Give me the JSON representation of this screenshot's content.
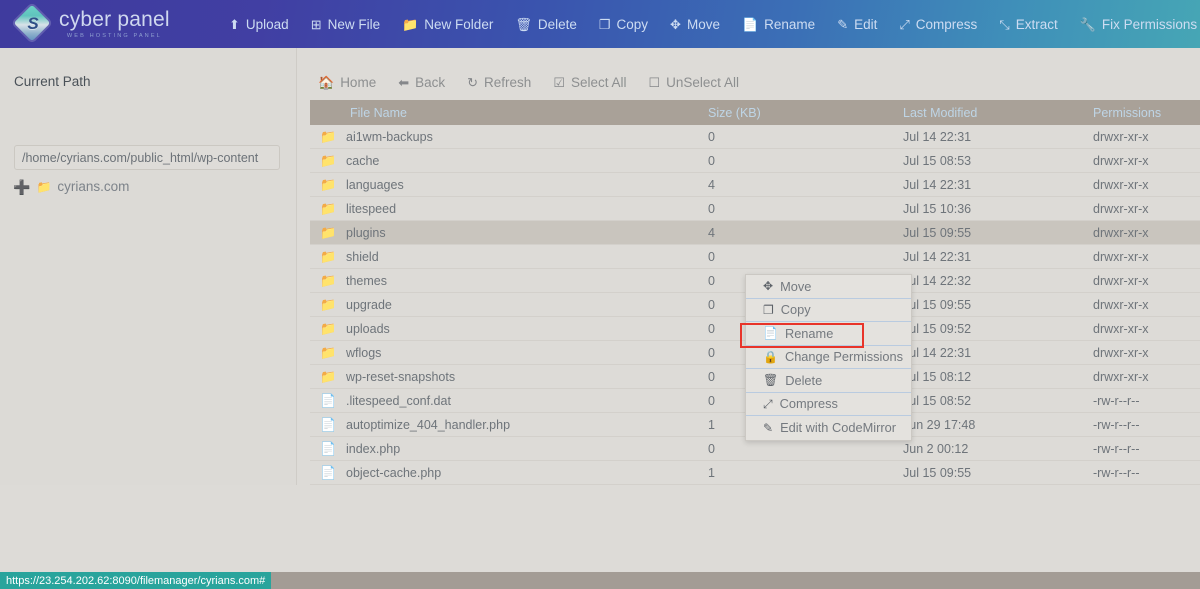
{
  "brand": {
    "name": "cyber panel",
    "tagline": "WEB HOSTING PANEL",
    "logo_icon": "diamond-logo-icon",
    "bolt_glyph": "S"
  },
  "topnav": {
    "items": [
      {
        "label": "Upload",
        "icon": "upload-icon",
        "glyph": "⬆"
      },
      {
        "label": "New File",
        "icon": "new-file-icon",
        "glyph": "⊞"
      },
      {
        "label": "New Folder",
        "icon": "new-folder-icon",
        "glyph": "📁"
      },
      {
        "label": "Delete",
        "icon": "trash-icon",
        "glyph": "🗑"
      },
      {
        "label": "Copy",
        "icon": "copy-icon",
        "glyph": "❐"
      },
      {
        "label": "Move",
        "icon": "move-icon",
        "glyph": "✥"
      },
      {
        "label": "Rename",
        "icon": "rename-document-icon",
        "glyph": "📄"
      },
      {
        "label": "Edit",
        "icon": "edit-pencil-icon",
        "glyph": "✎"
      },
      {
        "label": "Compress",
        "icon": "compress-icon",
        "glyph": "⤢"
      },
      {
        "label": "Extract",
        "icon": "extract-icon",
        "glyph": "⤡"
      },
      {
        "label": "Fix Permissions",
        "icon": "wrench-icon",
        "glyph": "🔧"
      }
    ]
  },
  "sidebar": {
    "title": "Current Path",
    "path_value": "/home/cyrians.com/public_html/wp-content",
    "path_placeholder": "/home/cyrians.com/public_html/wp-content",
    "tree": {
      "expand_glyph": "➕",
      "folder_icon": "folder-icon",
      "folder_glyph": "📁",
      "label": "cyrians.com"
    }
  },
  "actionbar": {
    "items": [
      {
        "label": "Home",
        "icon": "home-icon",
        "glyph": "🏠"
      },
      {
        "label": "Back",
        "icon": "arrow-left-icon",
        "glyph": "⬅"
      },
      {
        "label": "Refresh",
        "icon": "refresh-icon",
        "glyph": "↻"
      },
      {
        "label": "Select All",
        "icon": "checkbox-checked-icon",
        "glyph": "☑"
      },
      {
        "label": "UnSelect All",
        "icon": "checkbox-empty-icon",
        "glyph": "☐"
      }
    ]
  },
  "table": {
    "columns": [
      "File Name",
      "Size (KB)",
      "Last Modified",
      "Permissions"
    ],
    "rows": [
      {
        "name": "ai1wm-backups",
        "type": "folder",
        "size": "0",
        "modified": "Jul 14 22:31",
        "permissions": "drwxr-xr-x",
        "selected": false
      },
      {
        "name": "cache",
        "type": "folder",
        "size": "0",
        "modified": "Jul 15 08:53",
        "permissions": "drwxr-xr-x",
        "selected": false
      },
      {
        "name": "languages",
        "type": "folder",
        "size": "4",
        "modified": "Jul 14 22:31",
        "permissions": "drwxr-xr-x",
        "selected": false
      },
      {
        "name": "litespeed",
        "type": "folder",
        "size": "0",
        "modified": "Jul 15 10:36",
        "permissions": "drwxr-xr-x",
        "selected": false
      },
      {
        "name": "plugins",
        "type": "folder",
        "size": "4",
        "modified": "Jul 15 09:55",
        "permissions": "drwxr-xr-x",
        "selected": true
      },
      {
        "name": "shield",
        "type": "folder",
        "size": "0",
        "modified": "Jul 14 22:31",
        "permissions": "drwxr-xr-x",
        "selected": false
      },
      {
        "name": "themes",
        "type": "folder",
        "size": "0",
        "modified": "Jul 14 22:32",
        "permissions": "drwxr-xr-x",
        "selected": false
      },
      {
        "name": "upgrade",
        "type": "folder",
        "size": "0",
        "modified": "Jul 15 09:55",
        "permissions": "drwxr-xr-x",
        "selected": false
      },
      {
        "name": "uploads",
        "type": "folder",
        "size": "0",
        "modified": "Jul 15 09:52",
        "permissions": "drwxr-xr-x",
        "selected": false
      },
      {
        "name": "wflogs",
        "type": "folder",
        "size": "0",
        "modified": "Jul 14 22:31",
        "permissions": "drwxr-xr-x",
        "selected": false
      },
      {
        "name": "wp-reset-snapshots",
        "type": "folder",
        "size": "0",
        "modified": "Jul 15 08:12",
        "permissions": "drwxr-xr-x",
        "selected": false
      },
      {
        "name": ".litespeed_conf.dat",
        "type": "file",
        "size": "0",
        "modified": "Jul 15 08:52",
        "permissions": "-rw-r--r--",
        "selected": false
      },
      {
        "name": "autoptimize_404_handler.php",
        "type": "file",
        "size": "1",
        "modified": "Jun 29 17:48",
        "permissions": "-rw-r--r--",
        "selected": false
      },
      {
        "name": "index.php",
        "type": "file",
        "size": "0",
        "modified": "Jun 2 00:12",
        "permissions": "-rw-r--r--",
        "selected": false
      },
      {
        "name": "object-cache.php",
        "type": "file",
        "size": "1",
        "modified": "Jul 15 09:55",
        "permissions": "-rw-r--r--",
        "selected": false
      }
    ]
  },
  "context_menu": {
    "items": [
      {
        "label": "Move",
        "icon": "move-icon",
        "glyph": "✥"
      },
      {
        "label": "Copy",
        "icon": "copy-icon",
        "glyph": "❐"
      },
      {
        "label": "Rename",
        "icon": "document-icon",
        "glyph": "📄",
        "highlighted": true
      },
      {
        "label": "Change Permissions",
        "icon": "lock-icon",
        "glyph": "🔒"
      },
      {
        "label": "Delete",
        "icon": "trash-icon",
        "glyph": "🗑"
      },
      {
        "label": "Compress",
        "icon": "compress-icon",
        "glyph": "⤢"
      },
      {
        "label": "Edit with CodeMirror",
        "icon": "edit-pencil-icon",
        "glyph": "✎"
      }
    ],
    "highlight_color": "#e8342a"
  },
  "statusbar": {
    "url": "https://23.254.202.62:8090/filemanager/cyrians.com#",
    "background_color": "#29a49c"
  },
  "theme": {
    "page_background": "#dddbd7",
    "topbar_gradient_start": "#3f3b9e",
    "topbar_gradient_end": "#46a6b5",
    "table_header_background": "#a9a198",
    "table_header_text": "#bed5e6",
    "folder_icon_color": "#4a7ebb",
    "selected_row_background": "#c9c5be"
  }
}
